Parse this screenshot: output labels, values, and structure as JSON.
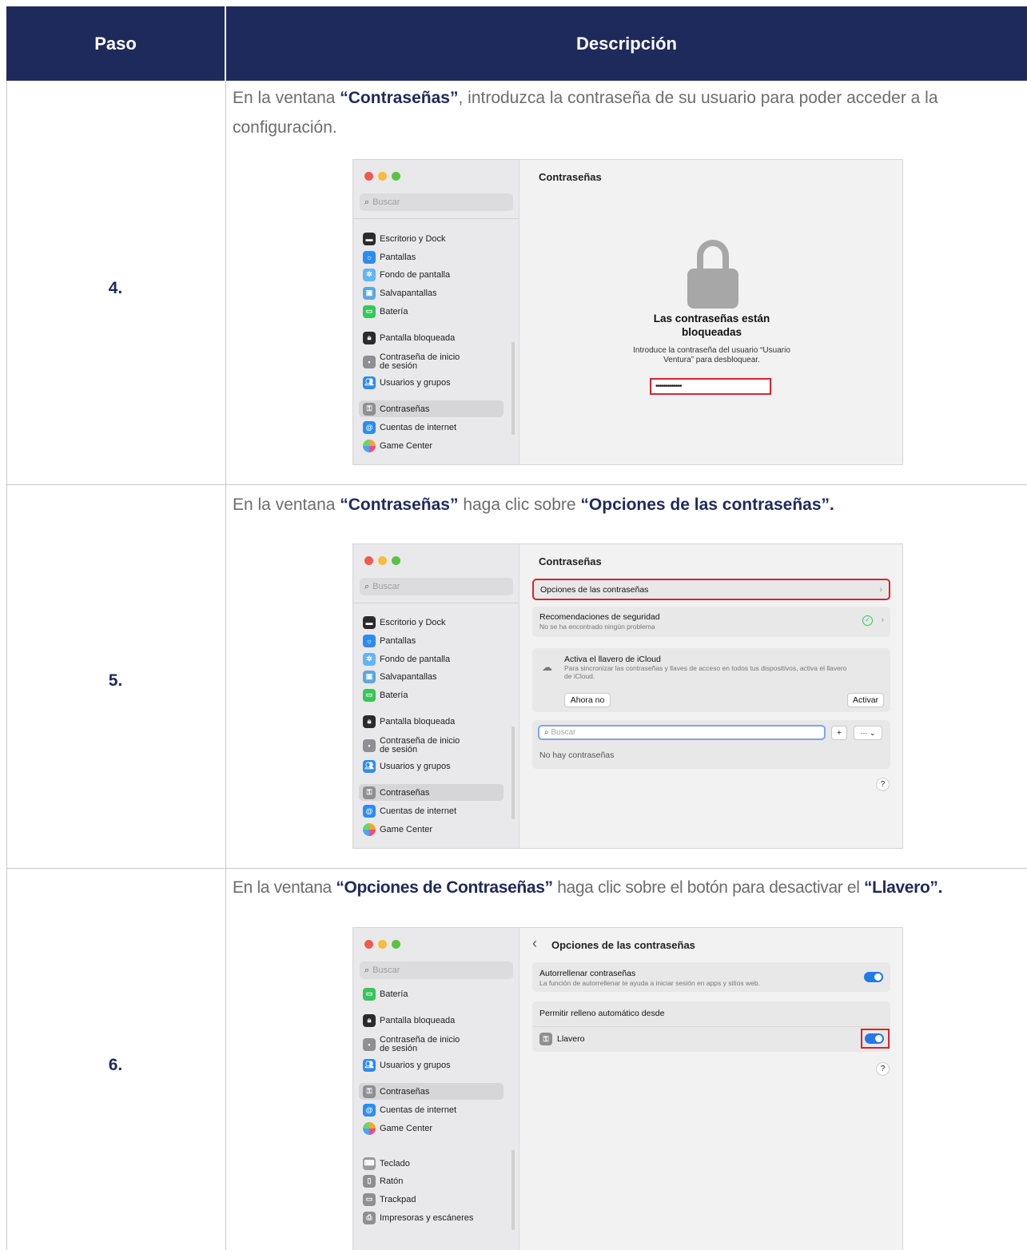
{
  "table": {
    "header_step": "Paso",
    "header_desc": "Descripción"
  },
  "steps": [
    {
      "num": "4.",
      "instr_pre": "En la ventana ",
      "instr_b1": "“Contraseñas”",
      "instr_mid": ", introduzca la contraseña de su usuario para poder acceder a la",
      "instr_line2": "configuración."
    },
    {
      "num": "5.",
      "instr_pre": "En la ventana ",
      "instr_b1": "“Contraseñas”",
      "instr_mid": " haga clic sobre ",
      "instr_b2": "“Opciones de las contraseñas”."
    },
    {
      "num": "6.",
      "instr_pre": "En la ventana ",
      "instr_b1": "“Opciones de Contraseñas”",
      "instr_mid": " haga clic sobre el botón para desactivar el ",
      "instr_b2": "“Llavero”."
    }
  ],
  "sidebar": {
    "search_placeholder": "Buscar",
    "items": {
      "salvapantallas": "Salvapantallas",
      "escritorio": "Escritorio y Dock",
      "pantallas": "Pantallas",
      "fondo": "Fondo de pantalla",
      "bateria": "Batería",
      "bloqueada": "Pantalla bloqueada",
      "contrasena_inicio": "Contraseña de inicio\nde sesión",
      "usuarios": "Usuarios y grupos",
      "contrasenas": "Contraseñas",
      "cuentas": "Cuentas de internet",
      "game_center": "Game Center",
      "teclado": "Teclado",
      "raton": "Ratón",
      "trackpad": "Trackpad",
      "impresoras": "Impresoras y escáneres"
    }
  },
  "win1": {
    "title": "Contraseñas",
    "locked_title": "Las contraseñas están\nbloqueadas",
    "locked_sub": "Introduce la contraseña del usuario “Usuario\nVentura” para desbloquear.",
    "password_mask": "•••••••••••••"
  },
  "win2": {
    "title": "Contraseñas",
    "options_label": "Opciones de las contraseñas",
    "security_title": "Recomendaciones de seguridad",
    "security_sub": "No se ha encontrado ningún problema",
    "icloud_title": "Activa el llavero de iCloud",
    "icloud_sub": "Para sincronizar las contraseñas y llaves de acceso en todos tus dispositivos, activa el llavero\nde iCloud.",
    "btn_not_now": "Ahora no",
    "btn_activate": "Activar",
    "search_placeholder": "Buscar",
    "no_passwords": "No hay contraseñas",
    "help": "?"
  },
  "win3": {
    "back": "‹",
    "title": "Opciones de las contraseñas",
    "autofill_title": "Autorrellenar contraseñas",
    "autofill_sub": "La función de autorrellenar te ayuda a iniciar sesión en apps y sitios web.",
    "allow_from": "Permitir relleno automático desde",
    "keychain": "Llavero",
    "help": "?"
  },
  "colors": {
    "header_bg": "#1f2a5c",
    "highlight": "#d9232e",
    "toggle_on": "#2677e8"
  }
}
